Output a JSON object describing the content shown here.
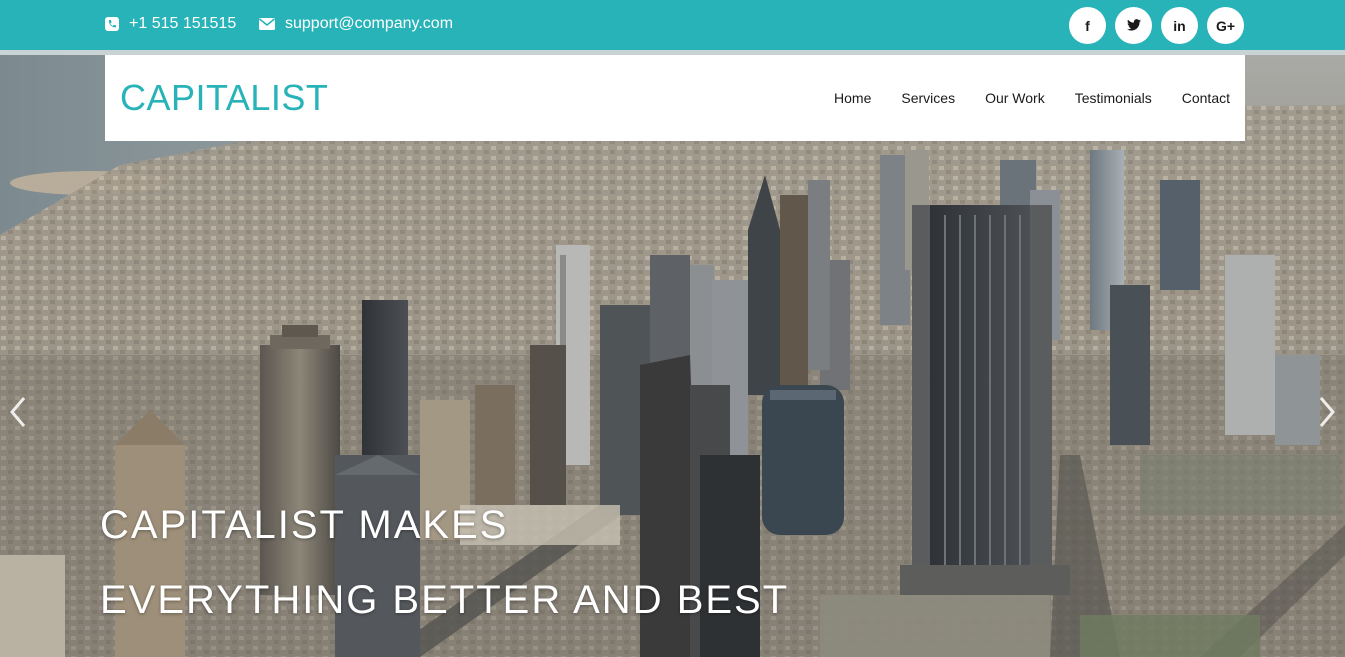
{
  "topbar": {
    "phone": "+1 515 151515",
    "email": "support@company.com",
    "phone_icon": "phone-icon",
    "email_icon": "envelope-icon",
    "bg_color": "#27b3b8"
  },
  "social": [
    {
      "name": "facebook",
      "glyph": "f"
    },
    {
      "name": "twitter",
      "glyph": "t"
    },
    {
      "name": "linkedin",
      "glyph": "in"
    },
    {
      "name": "google-plus",
      "glyph": "G+"
    }
  ],
  "brand": {
    "name": "CAPITALIST",
    "color": "#27b3b8"
  },
  "nav": {
    "items": [
      "Home",
      "Services",
      "Our Work",
      "Testimonials",
      "Contact"
    ]
  },
  "hero": {
    "headline": "CAPITALIST MAKES EVERYTHING BETTER AND BEST",
    "prev_icon": "chevron-left-icon",
    "next_icon": "chevron-right-icon"
  }
}
